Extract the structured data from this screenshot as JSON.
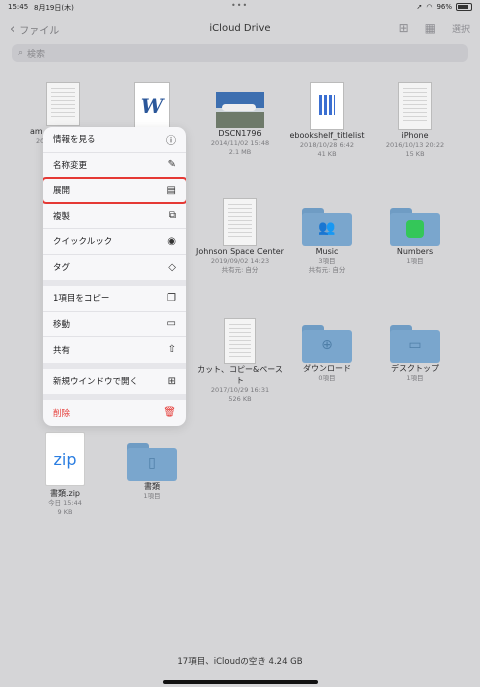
{
  "status": {
    "time": "15:45",
    "date": "8月19日(木)",
    "battery": "96%"
  },
  "nav": {
    "back": "ファイル",
    "title": "iCloud Drive",
    "select": "選択"
  },
  "search": {
    "placeholder": "検索"
  },
  "files": [
    {
      "name": "am",
      "meta1": "20",
      "meta2": ""
    },
    {
      "name": "",
      "meta1": "",
      "meta2": ""
    },
    {
      "name": "DSCN1796",
      "meta1": "2014/11/02 15:48",
      "meta2": "2.1 MB"
    },
    {
      "name": "ebookshelf_titlelist",
      "meta1": "2018/10/28 6:42",
      "meta2": "41 KB"
    },
    {
      "name": "iPhone",
      "meta1": "2016/10/13 20:22",
      "meta2": "15 KB"
    },
    {
      "name": "Johnson Space Center",
      "meta1": "2019/09/02 14:23",
      "meta2": "共有元: 自分"
    },
    {
      "name": "Music",
      "meta1": "3項目",
      "meta2": "共有元: 自分"
    },
    {
      "name": "Numbers",
      "meta1": "1項目",
      "meta2": ""
    },
    {
      "name": "カット、コピー&ペースト",
      "meta1": "2017/10/29 16:31",
      "meta2": "526 KB"
    },
    {
      "name": "ダウンロード",
      "meta1": "0項目",
      "meta2": ""
    },
    {
      "name": "デスクトップ",
      "meta1": "1項目",
      "meta2": ""
    },
    {
      "name": "書類.zip",
      "meta1": "今日 15:44",
      "meta2": "9 KB"
    },
    {
      "name": "書類",
      "meta1": "1項目",
      "meta2": ""
    }
  ],
  "zip_label": "zip",
  "menu": {
    "info": "情報を見る",
    "rename": "名称変更",
    "expand": "展開",
    "duplicate": "複製",
    "quicklook": "クイックルック",
    "tags": "タグ",
    "copy": "1項目をコピー",
    "move": "移動",
    "share": "共有",
    "newwindow": "新規ウインドウで開く",
    "delete": "削除"
  },
  "footer": "17項目、iCloudの空き 4.24 GB"
}
